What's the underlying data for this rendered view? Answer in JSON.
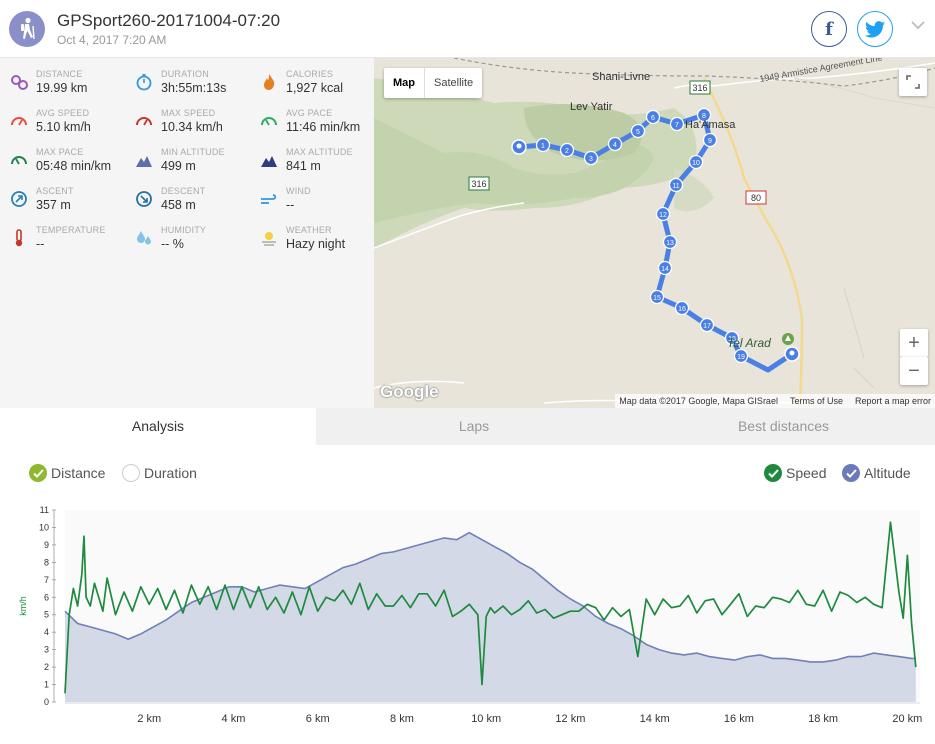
{
  "header": {
    "title": "GPSport260-20171004-07:20",
    "date": "Oct 4, 2017 7:20 AM",
    "facebook_label": "f"
  },
  "stats": [
    {
      "label": "DISTANCE",
      "value": "19.99 km",
      "icon": "route-icon",
      "color": "#9b59b6"
    },
    {
      "label": "DURATION",
      "value": "3h:55m:13s",
      "icon": "stopwatch-icon",
      "color": "#3498db"
    },
    {
      "label": "CALORIES",
      "value": "1,927 kcal",
      "icon": "flame-icon",
      "color": "#e67e22"
    },
    {
      "label": "AVG SPEED",
      "value": "5.10 km/h",
      "icon": "speedometer-icon",
      "color": "#e74c3c"
    },
    {
      "label": "MAX SPEED",
      "value": "10.34 km/h",
      "icon": "speedometer-icon",
      "color": "#c0392b"
    },
    {
      "label": "AVG PACE",
      "value": "11:46 min/km",
      "icon": "gauge-icon",
      "color": "#27ae60"
    },
    {
      "label": "MAX PACE",
      "value": "05:48 min/km",
      "icon": "gauge-icon",
      "color": "#1e8449"
    },
    {
      "label": "MIN ALTITUDE",
      "value": "499 m",
      "icon": "mountain-icon",
      "color": "#5b6fa8"
    },
    {
      "label": "MAX ALTITUDE",
      "value": "841 m",
      "icon": "mountain-icon",
      "color": "#2c3e80"
    },
    {
      "label": "ASCENT",
      "value": "357 m",
      "icon": "ascent-icon",
      "color": "#2980b9"
    },
    {
      "label": "DESCENT",
      "value": "458 m",
      "icon": "descent-icon",
      "color": "#2471a3"
    },
    {
      "label": "WIND",
      "value": "--",
      "icon": "wind-icon",
      "color": "#3498db"
    },
    {
      "label": "TEMPERATURE",
      "value": "--",
      "icon": "thermometer-icon",
      "color": "#c0392b"
    },
    {
      "label": "HUMIDITY",
      "value": "-- %",
      "icon": "droplets-icon",
      "color": "#85c1e9"
    },
    {
      "label": "WEATHER",
      "value": "Hazy night",
      "icon": "haze-icon",
      "color": "#f4d03f"
    }
  ],
  "map": {
    "type_map": "Map",
    "type_satellite": "Satellite",
    "zoom_in": "+",
    "zoom_out": "−",
    "footer_data": "Map data ©2017 Google, Mapa GISrael",
    "footer_terms": "Terms of Use",
    "footer_report": "Report a map error",
    "google_logo": "Google",
    "place_labels": [
      "Shani-Livne",
      "Lev Yatir",
      "Ha'Amasa",
      "Tel Arad"
    ],
    "road_labels": [
      "316",
      "316",
      "80",
      "1949 Armistice Agreement Line"
    ],
    "waypoints": [
      "1",
      "2",
      "3",
      "4",
      "5",
      "6",
      "7",
      "8",
      "9",
      "10",
      "11",
      "12",
      "13",
      "14",
      "15",
      "16",
      "17",
      "18",
      "19"
    ]
  },
  "tabs": [
    {
      "label": "Analysis",
      "active": true
    },
    {
      "label": "Laps",
      "active": false
    },
    {
      "label": "Best distances",
      "active": false
    }
  ],
  "toggles": {
    "distance": "Distance",
    "duration": "Duration",
    "speed": "Speed",
    "altitude": "Altitude"
  },
  "colors": {
    "speed": "#1e8a3e",
    "altitude_fill": "#d4d9e8",
    "altitude_line": "#7080b8",
    "route": "#4a7fe6",
    "check_green": "#1e8a3e",
    "check_purple": "#6b7ab8"
  },
  "chart_data": {
    "type": "line",
    "ylabel": "km/h",
    "xlabel": "",
    "xlim": [
      0,
      20.3
    ],
    "ylim": [
      0,
      11
    ],
    "xticks": [
      "2 km",
      "4 km",
      "6 km",
      "8 km",
      "10 km",
      "12 km",
      "14 km",
      "16 km",
      "18 km",
      "20 km"
    ],
    "xtick_values": [
      2,
      4,
      6,
      8,
      10,
      12,
      14,
      16,
      18,
      20
    ],
    "yticks": [
      "0",
      "1",
      "2",
      "3",
      "4",
      "5",
      "6",
      "7",
      "8",
      "9",
      "10",
      "11"
    ],
    "series": [
      {
        "name": "Speed",
        "x": [
          0,
          0.1,
          0.2,
          0.3,
          0.4,
          0.45,
          0.5,
          0.6,
          0.7,
          0.8,
          0.9,
          1.0,
          1.2,
          1.4,
          1.6,
          1.8,
          2.0,
          2.2,
          2.4,
          2.6,
          2.8,
          3.0,
          3.2,
          3.4,
          3.6,
          3.8,
          4.0,
          4.2,
          4.4,
          4.6,
          4.8,
          5.0,
          5.2,
          5.4,
          5.6,
          5.8,
          6.0,
          6.2,
          6.4,
          6.6,
          6.8,
          7.0,
          7.2,
          7.4,
          7.6,
          7.8,
          8.0,
          8.2,
          8.4,
          8.6,
          8.8,
          9.0,
          9.2,
          9.4,
          9.6,
          9.8,
          9.9,
          10.0,
          10.1,
          10.2,
          10.4,
          10.6,
          10.8,
          11.0,
          11.2,
          11.4,
          11.6,
          11.8,
          12.0,
          12.2,
          12.4,
          12.6,
          12.8,
          13.0,
          13.2,
          13.4,
          13.6,
          13.8,
          14.0,
          14.2,
          14.4,
          14.6,
          14.8,
          15.0,
          15.2,
          15.4,
          15.6,
          15.8,
          16.0,
          16.2,
          16.4,
          16.6,
          16.8,
          17.0,
          17.2,
          17.4,
          17.6,
          17.8,
          18.0,
          18.2,
          18.4,
          18.6,
          18.8,
          19.0,
          19.2,
          19.4,
          19.6,
          19.8,
          19.9,
          20.0,
          20.1,
          20.2
        ],
        "values": [
          0.5,
          5.0,
          6.5,
          5.5,
          7.3,
          9.5,
          6.0,
          5.5,
          6.8,
          6.0,
          5.2,
          7.1,
          5.0,
          6.3,
          5.2,
          6.6,
          5.6,
          6.5,
          5.3,
          6.4,
          5.1,
          6.7,
          5.6,
          6.6,
          5.3,
          6.7,
          5.3,
          6.6,
          5.4,
          6.6,
          5.3,
          6.0,
          5.1,
          6.3,
          5.0,
          6.6,
          5.2,
          6.0,
          5.8,
          6.4,
          5.6,
          6.8,
          5.3,
          6.2,
          5.5,
          5.5,
          6.1,
          5.4,
          6.2,
          6.2,
          5.5,
          6.4,
          4.9,
          5.2,
          5.6,
          5.0,
          1.0,
          4.9,
          5.4,
          5.1,
          5.5,
          5.0,
          5.3,
          5.8,
          5.1,
          5.3,
          4.8,
          5.0,
          5.2,
          5.2,
          5.6,
          5.4,
          4.7,
          5.4,
          4.9,
          5.3,
          2.6,
          5.9,
          5.0,
          5.9,
          5.4,
          5.5,
          6.1,
          5.1,
          5.8,
          5.9,
          5.0,
          5.6,
          6.2,
          4.9,
          5.5,
          5.4,
          6.0,
          5.9,
          5.7,
          6.4,
          5.6,
          5.5,
          6.4,
          5.2,
          6.3,
          6.1,
          5.7,
          6.0,
          5.6,
          5.4,
          10.3,
          6.3,
          4.8,
          8.4,
          4.5,
          2.0
        ]
      },
      {
        "name": "Altitude",
        "x": [
          0,
          0.3,
          0.6,
          0.9,
          1.2,
          1.5,
          1.8,
          2.1,
          2.4,
          2.7,
          3.0,
          3.3,
          3.6,
          3.9,
          4.2,
          4.5,
          4.8,
          5.1,
          5.4,
          5.7,
          6.0,
          6.3,
          6.6,
          6.9,
          7.2,
          7.5,
          7.8,
          8.1,
          8.4,
          8.7,
          9.0,
          9.3,
          9.6,
          9.9,
          10.2,
          10.5,
          10.8,
          11.1,
          11.4,
          11.7,
          12.0,
          12.3,
          12.6,
          12.9,
          13.2,
          13.5,
          13.8,
          14.1,
          14.4,
          14.7,
          15.0,
          15.3,
          15.6,
          15.9,
          16.2,
          16.5,
          16.8,
          17.1,
          17.4,
          17.7,
          18.0,
          18.3,
          18.6,
          18.9,
          19.2,
          19.5,
          19.8,
          20.1,
          20.2
        ],
        "values": [
          5.2,
          4.5,
          4.3,
          4.1,
          3.9,
          3.6,
          3.9,
          4.3,
          4.7,
          5.2,
          5.7,
          6.0,
          6.3,
          6.6,
          6.6,
          6.3,
          6.5,
          6.7,
          6.6,
          6.5,
          6.9,
          7.3,
          7.7,
          7.9,
          8.2,
          8.5,
          8.6,
          8.8,
          9.0,
          9.2,
          9.4,
          9.3,
          9.7,
          9.3,
          8.9,
          8.5,
          8.0,
          7.6,
          7.0,
          6.4,
          5.9,
          5.5,
          4.9,
          4.5,
          4.2,
          3.8,
          3.3,
          3.0,
          2.8,
          2.7,
          2.8,
          2.6,
          2.5,
          2.4,
          2.6,
          2.7,
          2.5,
          2.5,
          2.4,
          2.3,
          2.3,
          2.4,
          2.6,
          2.6,
          2.8,
          2.7,
          2.6,
          2.5,
          2.5
        ]
      }
    ]
  }
}
